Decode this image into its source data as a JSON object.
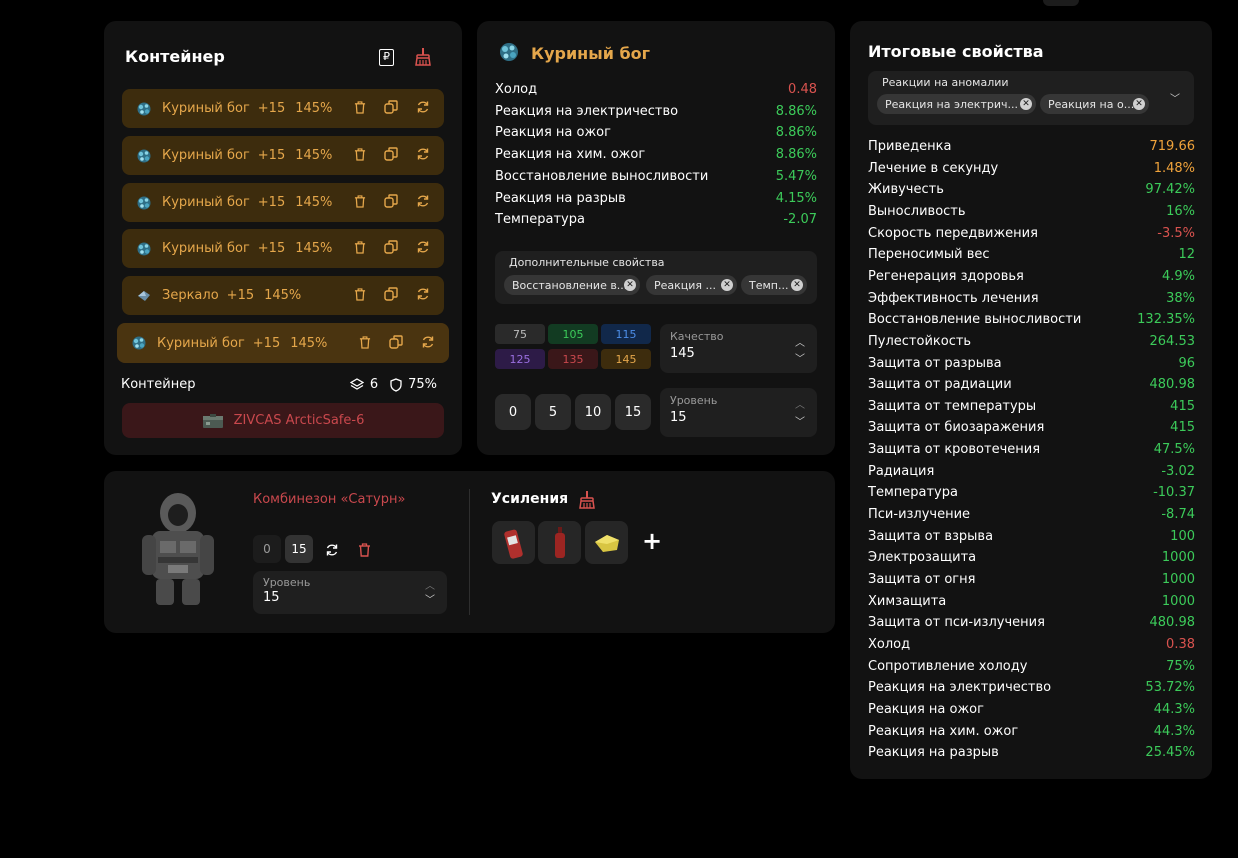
{
  "container": {
    "title": "Контейнер",
    "items": [
      {
        "name": "Куриный бог",
        "level": "+15",
        "pct": "145%",
        "gem": "chicken-god"
      },
      {
        "name": "Куриный бог",
        "level": "+15",
        "pct": "145%",
        "gem": "chicken-god"
      },
      {
        "name": "Куриный бог",
        "level": "+15",
        "pct": "145%",
        "gem": "chicken-god"
      },
      {
        "name": "Куриный бог",
        "level": "+15",
        "pct": "145%",
        "gem": "chicken-god"
      },
      {
        "name": "Зеркало",
        "level": "+15",
        "pct": "145%",
        "gem": "mirror"
      },
      {
        "name": "Куриный бог",
        "level": "+15",
        "pct": "145%",
        "gem": "chicken-god"
      }
    ],
    "footer_label": "Контейнер",
    "slots": "6",
    "protection": "75%",
    "case_name": "ZIVCAS ArcticSafe-6"
  },
  "artifact": {
    "title": "Куриный бог",
    "props": [
      {
        "name": "Холод",
        "value": "0.48",
        "color": "red"
      },
      {
        "name": "Реакция на электричество",
        "value": "8.86%",
        "color": "green"
      },
      {
        "name": "Реакция на ожог",
        "value": "8.86%",
        "color": "green"
      },
      {
        "name": "Реакция на хим. ожог",
        "value": "8.86%",
        "color": "green"
      },
      {
        "name": "Восстановление выносливости",
        "value": "5.47%",
        "color": "green"
      },
      {
        "name": "Реакция на разрыв",
        "value": "4.15%",
        "color": "green"
      },
      {
        "name": "Температура",
        "value": "-2.07",
        "color": "green"
      }
    ],
    "extra_label": "Дополнительные свойства",
    "extra_chips": [
      "Восстановление в...",
      "Реакция ...",
      "Темп..."
    ],
    "quality_cells": [
      {
        "value": "75",
        "bg": "#2a2a2a",
        "fg": "#bdbdbd"
      },
      {
        "value": "105",
        "bg": "#123b22",
        "fg": "#3ccb5a"
      },
      {
        "value": "115",
        "bg": "#11284a",
        "fg": "#4d8ee8"
      },
      {
        "value": "125",
        "bg": "#2d1b47",
        "fg": "#9a6fe0"
      },
      {
        "value": "135",
        "bg": "#3a1719",
        "fg": "#c9484d"
      },
      {
        "value": "145",
        "bg": "#3d2c0d",
        "fg": "#e5a74b"
      }
    ],
    "quality_label": "Качество",
    "quality_value": "145",
    "level_buttons": [
      "0",
      "5",
      "10",
      "15"
    ],
    "level_label": "Уровень",
    "level_value": "15"
  },
  "armor": {
    "name": "Комбинезон «Сатурн»",
    "levels": [
      "0",
      "15"
    ],
    "level_label": "Уровень",
    "level_value": "15",
    "boosts_title": "Усиления",
    "add_label": "+"
  },
  "totals": {
    "title": "Итоговые свойства",
    "filter_label": "Реакции на аномалии",
    "filter_chips": [
      "Реакция на электрич...",
      "Реакция на о..."
    ],
    "rows": [
      {
        "name": "Приведенка",
        "value": "719.66",
        "color": "orange"
      },
      {
        "name": "Лечение в секунду",
        "value": "1.48%",
        "color": "orange"
      },
      {
        "name": "Живучесть",
        "value": "97.42%",
        "color": "green"
      },
      {
        "name": "Выносливость",
        "value": "16%",
        "color": "green"
      },
      {
        "name": "Скорость передвижения",
        "value": "-3.5%",
        "color": "red"
      },
      {
        "name": "Переносимый вес",
        "value": "12",
        "color": "green"
      },
      {
        "name": "Регенерация здоровья",
        "value": "4.9%",
        "color": "green"
      },
      {
        "name": "Эффективность лечения",
        "value": "38%",
        "color": "green"
      },
      {
        "name": "Восстановление выносливости",
        "value": "132.35%",
        "color": "green"
      },
      {
        "name": "Пулестойкость",
        "value": "264.53",
        "color": "green"
      },
      {
        "name": "Защита от разрыва",
        "value": "96",
        "color": "green"
      },
      {
        "name": "Защита от радиации",
        "value": "480.98",
        "color": "green"
      },
      {
        "name": "Защита от температуры",
        "value": "415",
        "color": "green"
      },
      {
        "name": "Защита от биозаражения",
        "value": "415",
        "color": "green"
      },
      {
        "name": "Защита от кровотечения",
        "value": "47.5%",
        "color": "green"
      },
      {
        "name": "Радиация",
        "value": "-3.02",
        "color": "green"
      },
      {
        "name": "Температура",
        "value": "-10.37",
        "color": "green"
      },
      {
        "name": "Пси-излучение",
        "value": "-8.74",
        "color": "green"
      },
      {
        "name": "Защита от взрыва",
        "value": "100",
        "color": "green"
      },
      {
        "name": "Электрозащита",
        "value": "1000",
        "color": "green"
      },
      {
        "name": "Защита от огня",
        "value": "1000",
        "color": "green"
      },
      {
        "name": "Химзащита",
        "value": "1000",
        "color": "green"
      },
      {
        "name": "Защита от пси-излучения",
        "value": "480.98",
        "color": "green"
      },
      {
        "name": "Холод",
        "value": "0.38",
        "color": "red"
      },
      {
        "name": "Сопротивление холоду",
        "value": "75%",
        "color": "green"
      },
      {
        "name": "Реакция на электричество",
        "value": "53.72%",
        "color": "green"
      },
      {
        "name": "Реакция на ожог",
        "value": "44.3%",
        "color": "green"
      },
      {
        "name": "Реакция на хим. ожог",
        "value": "44.3%",
        "color": "green"
      },
      {
        "name": "Реакция на разрыв",
        "value": "25.45%",
        "color": "green"
      }
    ]
  }
}
